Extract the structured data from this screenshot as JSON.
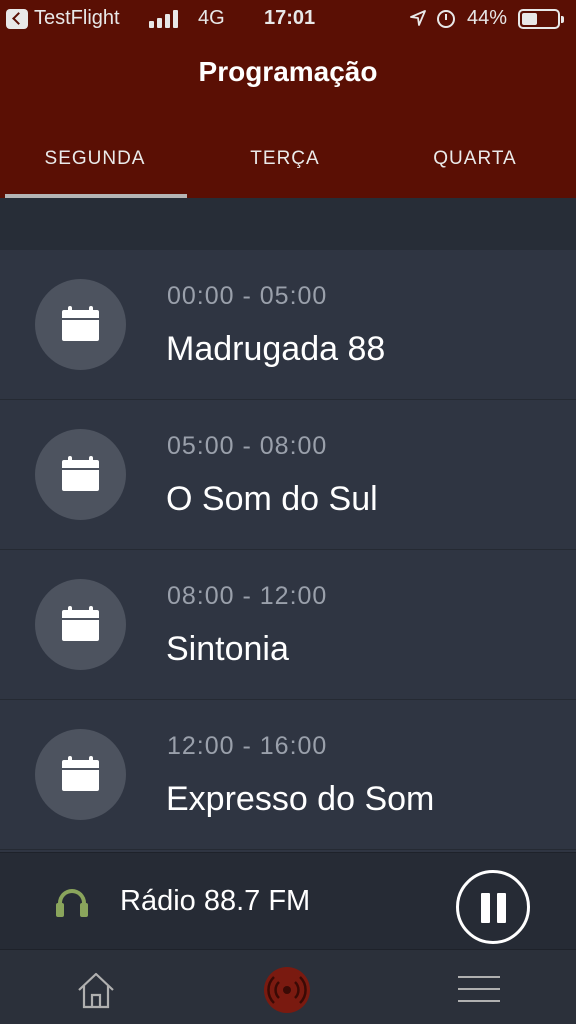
{
  "status_bar": {
    "app": "TestFlight",
    "network": "4G",
    "time": "17:01",
    "battery": "44%"
  },
  "header": {
    "title": "Programação",
    "tabs": [
      {
        "label": "SEGUNDA",
        "active": true
      },
      {
        "label": "TERÇA",
        "active": false
      },
      {
        "label": "QUARTA",
        "active": false
      }
    ]
  },
  "schedule": [
    {
      "time": "00:00 - 05:00",
      "name": "Madrugada 88",
      "icon": "calendar-icon"
    },
    {
      "time": "05:00 - 08:00",
      "name": "O Som do Sul",
      "icon": "calendar-icon"
    },
    {
      "time": "08:00 - 12:00",
      "name": "Sintonia",
      "icon": "calendar-icon"
    },
    {
      "time": "12:00 - 16:00",
      "name": "Expresso do Som",
      "icon": "calendar-icon"
    }
  ],
  "player": {
    "station": "Rádio 88.7 FM",
    "icon": "headphones-icon",
    "state": "playing",
    "accent": "#8aa55c"
  },
  "bottom_nav": {
    "items": [
      {
        "icon": "home-icon"
      },
      {
        "icon": "radio-live-icon"
      },
      {
        "icon": "menu-icon"
      }
    ]
  },
  "colors": {
    "header": "#5a0f04",
    "background": "#2f3542",
    "icon_circle": "#4d535f"
  }
}
